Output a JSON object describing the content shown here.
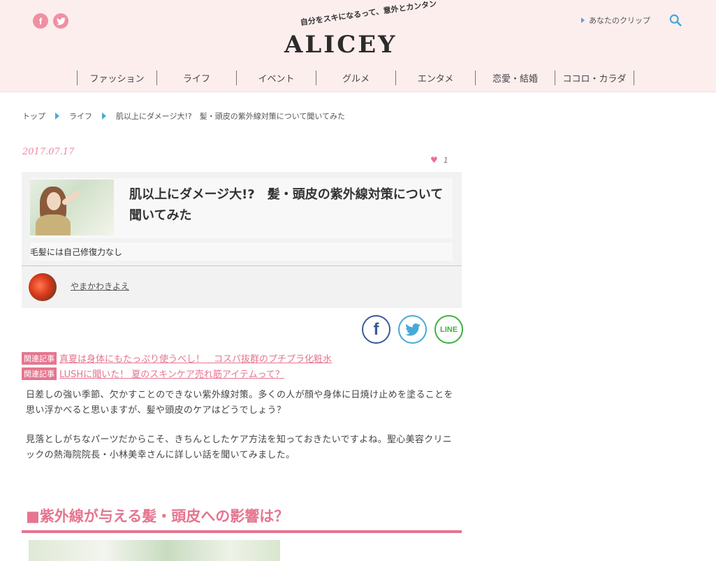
{
  "header": {
    "social": [
      {
        "icon": "facebook-icon",
        "glyph": "f"
      },
      {
        "icon": "twitter-icon",
        "glyph": "t"
      }
    ],
    "tagline": "自分をスキになるって、意外とカンタン",
    "logo": "ALICEY",
    "clip_label": "あなたのクリップ",
    "accent_color": "#e6758f",
    "link_color": "#4aa8d8"
  },
  "nav": [
    "ファッション",
    "ライフ",
    "イベント",
    "グルメ",
    "エンタメ",
    "恋愛・結婚",
    "ココロ・カラダ"
  ],
  "breadcrumb": [
    "トップ",
    "ライフ",
    "肌以上にダメージ大!?　髪・頭皮の紫外線対策について聞いてみた"
  ],
  "article": {
    "date": "2017.07.17",
    "likes": "1",
    "title": "肌以上にダメージ大!?　髪・頭皮の紫外線対策について聞いてみた",
    "subtitle": "毛髪には自己修復力なし",
    "author": "やまかわきよえ"
  },
  "share": {
    "facebook": "f",
    "line": "LINE"
  },
  "related": [
    {
      "tag": "関連記事",
      "text": "真夏は身体にもたっぷり使うべし！　コスパ抜群のプチプラ化粧水"
    },
    {
      "tag": "関連記事",
      "text": "LUSHに聞いた！ 夏のスキンケア売れ筋アイテムって？"
    }
  ],
  "body": [
    "日差しの強い季節、欠かすことのできない紫外線対策。多くの人が顔や身体に日焼け止めを塗ることを思い浮かべると思いますが、髪や頭皮のケアはどうでしょう？",
    "見落としがちなパーツだからこそ、きちんとしたケア方法を知っておきたいですよね。聖心美容クリニックの熱海院院長・小林美幸さんに詳しい話を聞いてみました。"
  ],
  "section_heading": "■紫外線が与える髪・頭皮への影響は？"
}
